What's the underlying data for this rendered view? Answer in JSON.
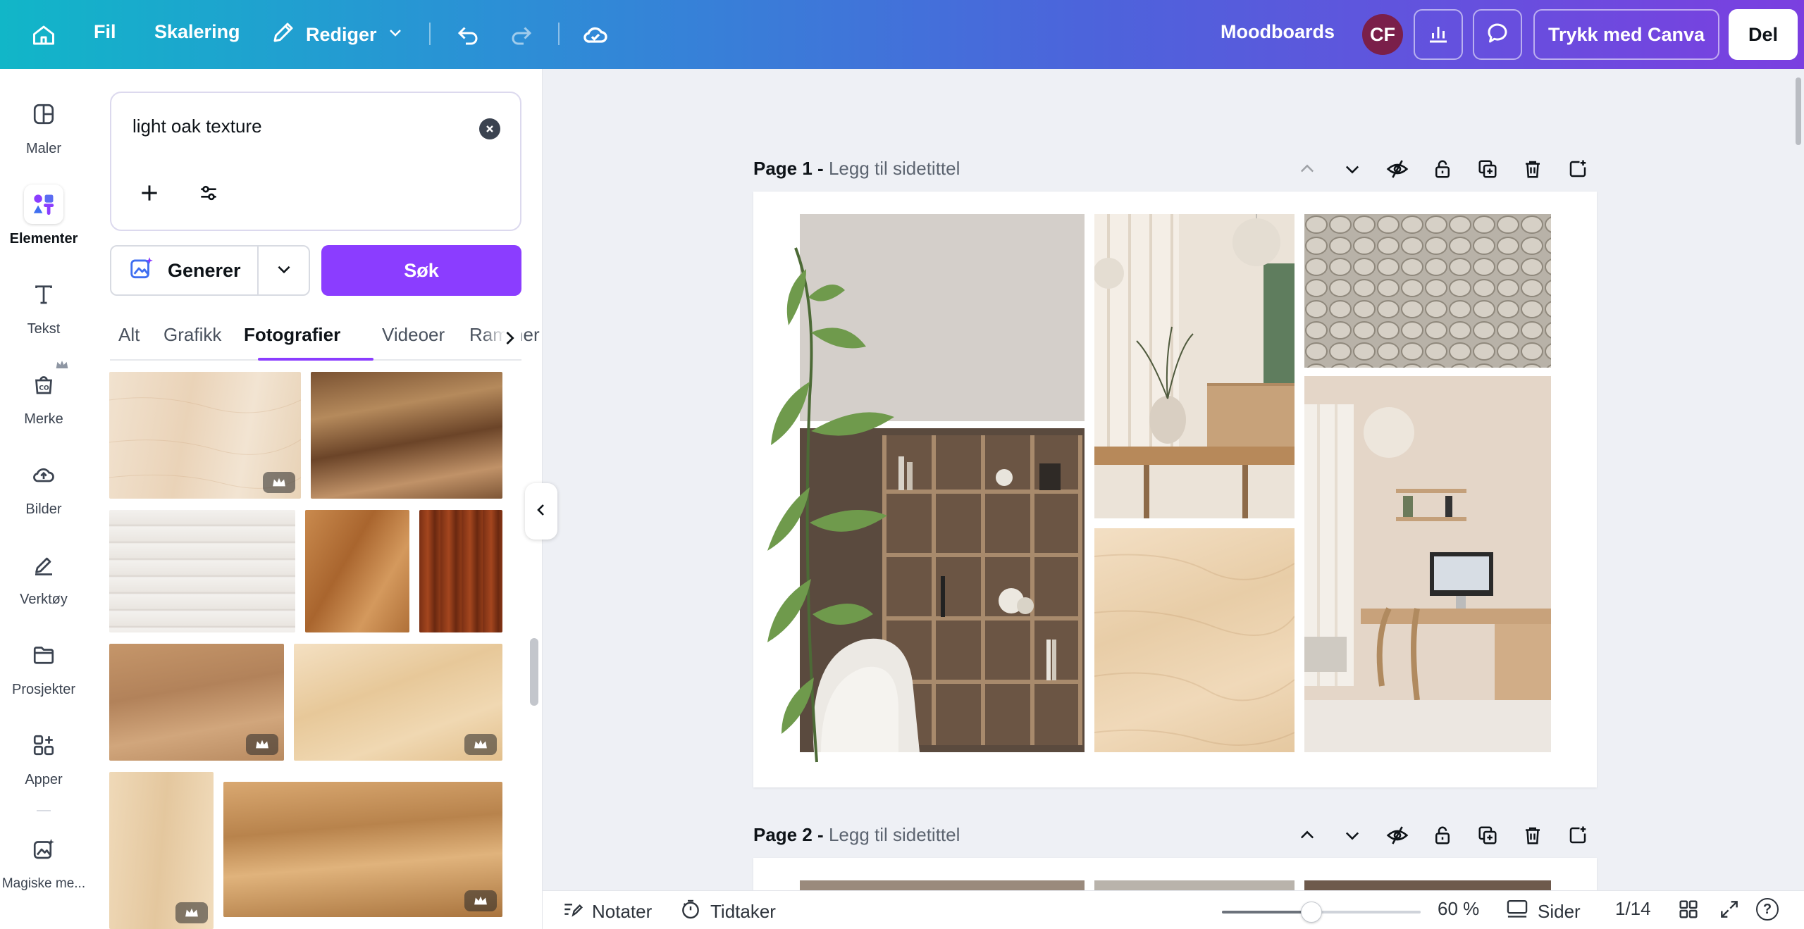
{
  "topbar": {
    "file_label": "Fil",
    "resize_label": "Skalering",
    "edit_label": "Rediger",
    "project_name": "Moodboards",
    "avatar_initials": "CF",
    "print_label": "Trykk med Canva",
    "share_label": "Del"
  },
  "rail": {
    "items": [
      {
        "label": "Maler",
        "icon": "layout-icon"
      },
      {
        "label": "Elementer",
        "icon": "elements-icon"
      },
      {
        "label": "Tekst",
        "icon": "text-icon"
      },
      {
        "label": "Merke",
        "icon": "brand-icon"
      },
      {
        "label": "Bilder",
        "icon": "upload-cloud-icon"
      },
      {
        "label": "Verktøy",
        "icon": "draw-icon"
      },
      {
        "label": "Prosjekter",
        "icon": "folder-icon"
      },
      {
        "label": "Apper",
        "icon": "apps-icon"
      },
      {
        "label": "Magiske me...",
        "icon": "magic-icon"
      }
    ]
  },
  "panel": {
    "search_query": "light oak texture",
    "generate_label": "Generer",
    "search_button_label": "Søk",
    "tabs": [
      "Alt",
      "Grafikk",
      "Fotografier",
      "Videoer",
      "Rammer"
    ],
    "active_tab": "Fotografier"
  },
  "pages": [
    {
      "number_label": "Page 1 -",
      "title_placeholder": "Legg til sidetittel"
    },
    {
      "number_label": "Page 2 -",
      "title_placeholder": "Legg til sidetittel"
    }
  ],
  "bottombar": {
    "notes_label": "Notater",
    "timer_label": "Tidtaker",
    "zoom_label": "60 %",
    "zoom_level": 0.45,
    "pages_label": "Sider",
    "page_counter": "1/14",
    "help_label": "?"
  },
  "colors": {
    "accent": "#8b3dff",
    "avatar": "#7a1f4a"
  }
}
